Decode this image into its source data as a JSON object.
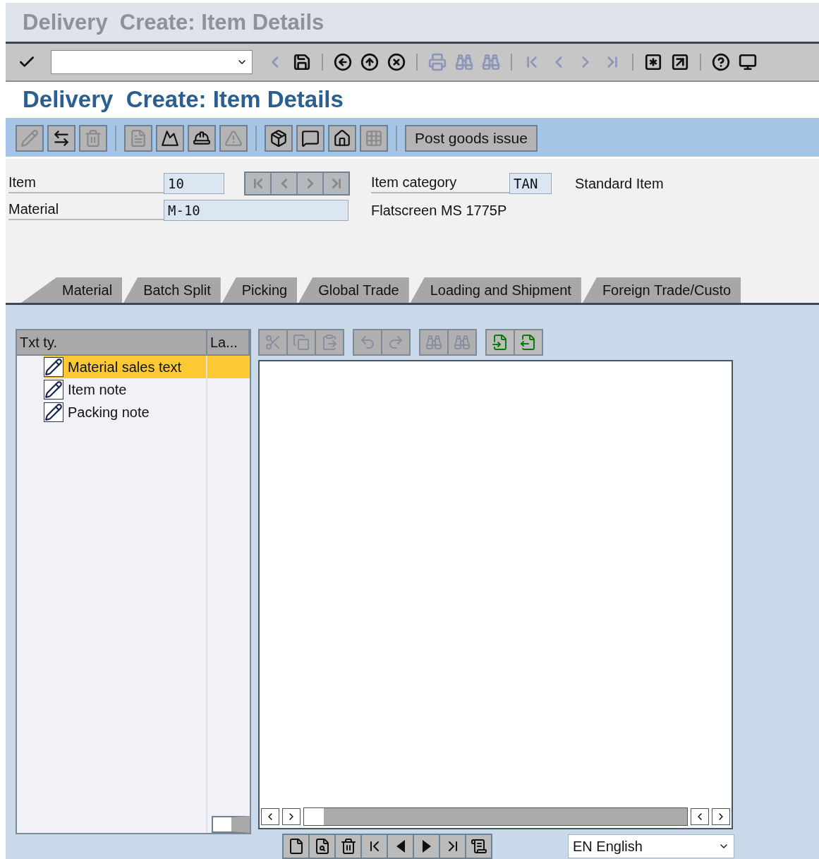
{
  "window": {
    "title": "Delivery  Create: Item Details"
  },
  "screen_title": "Delivery  Create: Item Details",
  "app_toolbar": {
    "icon_groups": [
      [
        {
          "kind": "change",
          "disabled": true
        },
        {
          "kind": "swap",
          "disabled": false
        },
        {
          "kind": "delete",
          "disabled": true
        }
      ],
      [
        {
          "kind": "document",
          "disabled": true
        },
        {
          "kind": "mountain",
          "disabled": false
        },
        {
          "kind": "hat",
          "disabled": false
        },
        {
          "kind": "warning",
          "disabled": true
        }
      ],
      [
        {
          "kind": "package",
          "disabled": false
        },
        {
          "kind": "help",
          "disabled": false
        },
        {
          "kind": "house",
          "disabled": false
        },
        {
          "kind": "grid",
          "disabled": true
        }
      ]
    ],
    "text_button": "Post goods issue"
  },
  "header": {
    "item": {
      "label": "Item",
      "value": "10"
    },
    "item_category": {
      "label": "Item category",
      "value": "TAN",
      "description": "Standard Item"
    },
    "material": {
      "label": "Material",
      "value": "M-10",
      "description": "Flatscreen MS 1775P"
    }
  },
  "tabs": [
    "Material",
    "Batch Split",
    "Picking",
    "Global Trade",
    "Loading and Shipment",
    "Foreign Trade/Custo"
  ],
  "text_types": {
    "columns": [
      "Txt ty.",
      "La..."
    ],
    "rows": [
      {
        "text_type": "Material sales text",
        "selected": true
      },
      {
        "text_type": "Item note",
        "selected": false
      },
      {
        "text_type": "Packing note",
        "selected": false
      }
    ]
  },
  "editor_toolbar": [
    [
      {
        "kind": "cut",
        "disabled": true
      },
      {
        "kind": "copy",
        "disabled": true
      },
      {
        "kind": "paste",
        "disabled": true
      }
    ],
    [
      {
        "kind": "undo",
        "disabled": true
      },
      {
        "kind": "redo",
        "disabled": true
      }
    ],
    [
      {
        "kind": "find",
        "disabled": true
      },
      {
        "kind": "find-next",
        "disabled": true
      }
    ],
    [
      {
        "kind": "import",
        "disabled": false
      },
      {
        "kind": "export",
        "disabled": false
      }
    ]
  ],
  "language": {
    "value": "EN English"
  }
}
